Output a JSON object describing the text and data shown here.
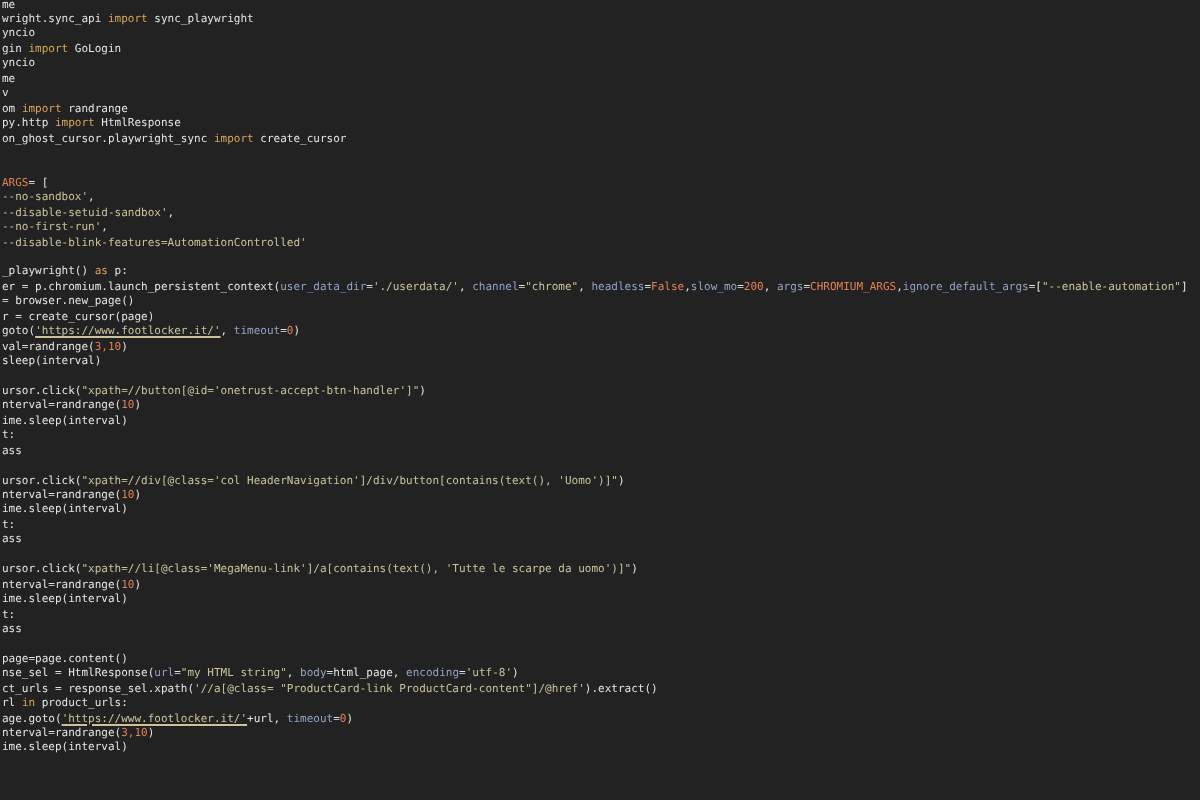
{
  "editor": {
    "lines": [
      {
        "kind": "code",
        "tokens": [
          {
            "kind": "plain",
            "text": "me"
          }
        ]
      },
      {
        "kind": "code",
        "tokens": [
          {
            "kind": "plain",
            "text": "wright.sync_api "
          },
          {
            "kind": "keyword",
            "text": "import"
          },
          {
            "kind": "plain",
            "text": " sync_playwright"
          }
        ]
      },
      {
        "kind": "code",
        "tokens": [
          {
            "kind": "plain",
            "text": "yncio"
          }
        ]
      },
      {
        "kind": "code",
        "tokens": [
          {
            "kind": "plain",
            "text": "gin "
          },
          {
            "kind": "keyword",
            "text": "import"
          },
          {
            "kind": "plain",
            "text": " GoLogin"
          }
        ]
      },
      {
        "kind": "code",
        "tokens": [
          {
            "kind": "plain",
            "text": "yncio"
          }
        ]
      },
      {
        "kind": "code",
        "tokens": [
          {
            "kind": "plain",
            "text": "me"
          }
        ]
      },
      {
        "kind": "code",
        "tokens": [
          {
            "kind": "plain",
            "text": "v"
          }
        ]
      },
      {
        "kind": "code",
        "tokens": [
          {
            "kind": "plain",
            "text": "om "
          },
          {
            "kind": "keyword",
            "text": "import"
          },
          {
            "kind": "plain",
            "text": " randrange"
          }
        ]
      },
      {
        "kind": "code",
        "tokens": [
          {
            "kind": "plain",
            "text": "py.http "
          },
          {
            "kind": "keyword",
            "text": "import"
          },
          {
            "kind": "plain",
            "text": " HtmlResponse"
          }
        ]
      },
      {
        "kind": "code",
        "tokens": [
          {
            "kind": "plain",
            "text": "on_ghost_cursor.playwright_sync "
          },
          {
            "kind": "keyword",
            "text": "import"
          },
          {
            "kind": "plain",
            "text": " create_cursor"
          }
        ]
      },
      {
        "kind": "blank"
      },
      {
        "kind": "blank"
      },
      {
        "kind": "code",
        "tokens": [
          {
            "kind": "constant",
            "text": "ARGS"
          },
          {
            "kind": "plain",
            "text": "= ["
          }
        ]
      },
      {
        "kind": "code",
        "tokens": [
          {
            "kind": "string",
            "text": "--no-sandbox'"
          },
          {
            "kind": "plain",
            "text": ","
          }
        ]
      },
      {
        "kind": "code",
        "tokens": [
          {
            "kind": "string",
            "text": "--disable-setuid-sandbox'"
          },
          {
            "kind": "plain",
            "text": ","
          }
        ]
      },
      {
        "kind": "code",
        "tokens": [
          {
            "kind": "string",
            "text": "--no-first-run'"
          },
          {
            "kind": "plain",
            "text": ","
          }
        ]
      },
      {
        "kind": "code",
        "tokens": [
          {
            "kind": "string",
            "text": "--disable-blink-features=AutomationControlled'"
          }
        ]
      },
      {
        "kind": "blank"
      },
      {
        "kind": "code",
        "tokens": [
          {
            "kind": "plain",
            "text": "_playwright() "
          },
          {
            "kind": "keyword",
            "text": "as"
          },
          {
            "kind": "plain",
            "text": " p:"
          }
        ]
      },
      {
        "kind": "code",
        "tokens": [
          {
            "kind": "plain",
            "text": "er = p.chromium.launch_persistent_context("
          },
          {
            "kind": "param",
            "text": "user_data_dir"
          },
          {
            "kind": "plain",
            "text": "="
          },
          {
            "kind": "string",
            "text": "'./userdata/'"
          },
          {
            "kind": "plain",
            "text": ", "
          },
          {
            "kind": "param",
            "text": "channel"
          },
          {
            "kind": "plain",
            "text": "="
          },
          {
            "kind": "string",
            "text": "\"chrome\""
          },
          {
            "kind": "plain",
            "text": ", "
          },
          {
            "kind": "param",
            "text": "headless"
          },
          {
            "kind": "plain",
            "text": "="
          },
          {
            "kind": "constant",
            "text": "False"
          },
          {
            "kind": "plain",
            "text": ","
          },
          {
            "kind": "param",
            "text": "slow_mo"
          },
          {
            "kind": "plain",
            "text": "="
          },
          {
            "kind": "constant",
            "text": "200"
          },
          {
            "kind": "plain",
            "text": ", "
          },
          {
            "kind": "param",
            "text": "args"
          },
          {
            "kind": "plain",
            "text": "="
          },
          {
            "kind": "constant",
            "text": "CHROMIUM_ARGS"
          },
          {
            "kind": "plain",
            "text": ","
          },
          {
            "kind": "param",
            "text": "ignore_default_args"
          },
          {
            "kind": "plain",
            "text": "=["
          },
          {
            "kind": "string",
            "text": "\"--enable-automation\""
          },
          {
            "kind": "plain",
            "text": "]"
          }
        ]
      },
      {
        "kind": "code",
        "tokens": [
          {
            "kind": "plain",
            "text": "= browser.new_page()"
          }
        ]
      },
      {
        "kind": "code",
        "tokens": [
          {
            "kind": "plain",
            "text": "r = create_cursor(page)"
          }
        ]
      },
      {
        "kind": "code",
        "tokens": [
          {
            "kind": "plain",
            "text": "goto("
          },
          {
            "kind": "link",
            "text": "'https://www.footlocker.it/'"
          },
          {
            "kind": "plain",
            "text": ", "
          },
          {
            "kind": "param",
            "text": "timeout"
          },
          {
            "kind": "plain",
            "text": "="
          },
          {
            "kind": "constant",
            "text": "0"
          },
          {
            "kind": "plain",
            "text": ")"
          }
        ]
      },
      {
        "kind": "code",
        "tokens": [
          {
            "kind": "plain",
            "text": "val=randrange("
          },
          {
            "kind": "constant",
            "text": "3,10"
          },
          {
            "kind": "plain",
            "text": ")"
          }
        ]
      },
      {
        "kind": "code",
        "tokens": [
          {
            "kind": "plain",
            "text": "sleep(interval)"
          }
        ]
      },
      {
        "kind": "blank"
      },
      {
        "kind": "code",
        "tokens": [
          {
            "kind": "plain",
            "text": "ursor.click("
          },
          {
            "kind": "string",
            "text": "\"xpath=//button[@id='onetrust-accept-btn-handler']\""
          },
          {
            "kind": "plain",
            "text": ")"
          }
        ]
      },
      {
        "kind": "code",
        "tokens": [
          {
            "kind": "plain",
            "text": "nterval=randrange("
          },
          {
            "kind": "constant",
            "text": "10"
          },
          {
            "kind": "plain",
            "text": ")"
          }
        ]
      },
      {
        "kind": "code",
        "tokens": [
          {
            "kind": "plain",
            "text": "ime.sleep(interval)"
          }
        ]
      },
      {
        "kind": "code",
        "tokens": [
          {
            "kind": "plain",
            "text": "t:"
          }
        ]
      },
      {
        "kind": "code",
        "tokens": [
          {
            "kind": "plain",
            "text": "ass"
          }
        ]
      },
      {
        "kind": "blank"
      },
      {
        "kind": "code",
        "tokens": [
          {
            "kind": "plain",
            "text": "ursor.click("
          },
          {
            "kind": "string",
            "text": "\"xpath=//div[@class='col HeaderNavigation']/div/button[contains(text(), 'Uomo')]\""
          },
          {
            "kind": "plain",
            "text": ")"
          }
        ]
      },
      {
        "kind": "code",
        "tokens": [
          {
            "kind": "plain",
            "text": "nterval=randrange("
          },
          {
            "kind": "constant",
            "text": "10"
          },
          {
            "kind": "plain",
            "text": ")"
          }
        ]
      },
      {
        "kind": "code",
        "tokens": [
          {
            "kind": "plain",
            "text": "ime.sleep(interval)"
          }
        ]
      },
      {
        "kind": "code",
        "tokens": [
          {
            "kind": "plain",
            "text": "t:"
          }
        ]
      },
      {
        "kind": "code",
        "tokens": [
          {
            "kind": "plain",
            "text": "ass"
          }
        ]
      },
      {
        "kind": "blank"
      },
      {
        "kind": "code",
        "tokens": [
          {
            "kind": "plain",
            "text": "ursor.click("
          },
          {
            "kind": "string",
            "text": "\"xpath=//li[@class='MegaMenu-link']/a[contains(text(), 'Tutte le scarpe da uomo')]\""
          },
          {
            "kind": "plain",
            "text": ")"
          }
        ]
      },
      {
        "kind": "code",
        "tokens": [
          {
            "kind": "plain",
            "text": "nterval=randrange("
          },
          {
            "kind": "constant",
            "text": "10"
          },
          {
            "kind": "plain",
            "text": ")"
          }
        ]
      },
      {
        "kind": "code",
        "tokens": [
          {
            "kind": "plain",
            "text": "ime.sleep(interval)"
          }
        ]
      },
      {
        "kind": "code",
        "tokens": [
          {
            "kind": "plain",
            "text": "t:"
          }
        ]
      },
      {
        "kind": "code",
        "tokens": [
          {
            "kind": "plain",
            "text": "ass"
          }
        ]
      },
      {
        "kind": "blank"
      },
      {
        "kind": "code",
        "tokens": [
          {
            "kind": "plain",
            "text": "page=page.content()"
          }
        ]
      },
      {
        "kind": "code",
        "tokens": [
          {
            "kind": "plain",
            "text": "nse_sel = HtmlResponse("
          },
          {
            "kind": "param",
            "text": "url"
          },
          {
            "kind": "plain",
            "text": "="
          },
          {
            "kind": "string",
            "text": "\"my HTML string\""
          },
          {
            "kind": "plain",
            "text": ", "
          },
          {
            "kind": "param",
            "text": "body"
          },
          {
            "kind": "plain",
            "text": "=html_page, "
          },
          {
            "kind": "param",
            "text": "encoding"
          },
          {
            "kind": "plain",
            "text": "="
          },
          {
            "kind": "string",
            "text": "'utf-8'"
          },
          {
            "kind": "plain",
            "text": ")"
          }
        ]
      },
      {
        "kind": "code",
        "tokens": [
          {
            "kind": "plain",
            "text": "ct_urls = response_sel.xpath("
          },
          {
            "kind": "string",
            "text": "'//a[@class= \"ProductCard-link ProductCard-content\"]/@href'"
          },
          {
            "kind": "plain",
            "text": ").extract()"
          }
        ]
      },
      {
        "kind": "code",
        "tokens": [
          {
            "kind": "plain",
            "text": "rl "
          },
          {
            "kind": "keyword",
            "text": "in"
          },
          {
            "kind": "plain",
            "text": " product_urls:"
          }
        ]
      },
      {
        "kind": "code",
        "tokens": [
          {
            "kind": "plain",
            "text": "age.goto("
          },
          {
            "kind": "link",
            "text": "'https://www.footlocker.it/'"
          },
          {
            "kind": "plain",
            "text": "+url, "
          },
          {
            "kind": "param",
            "text": "timeout"
          },
          {
            "kind": "plain",
            "text": "="
          },
          {
            "kind": "constant",
            "text": "0"
          },
          {
            "kind": "plain",
            "text": ")"
          }
        ]
      },
      {
        "kind": "code",
        "tokens": [
          {
            "kind": "plain",
            "text": "nterval=randrange("
          },
          {
            "kind": "constant",
            "text": "3,10"
          },
          {
            "kind": "plain",
            "text": ")"
          }
        ]
      },
      {
        "kind": "code",
        "tokens": [
          {
            "kind": "plain",
            "text": "ime.sleep(interval)"
          }
        ]
      }
    ]
  }
}
